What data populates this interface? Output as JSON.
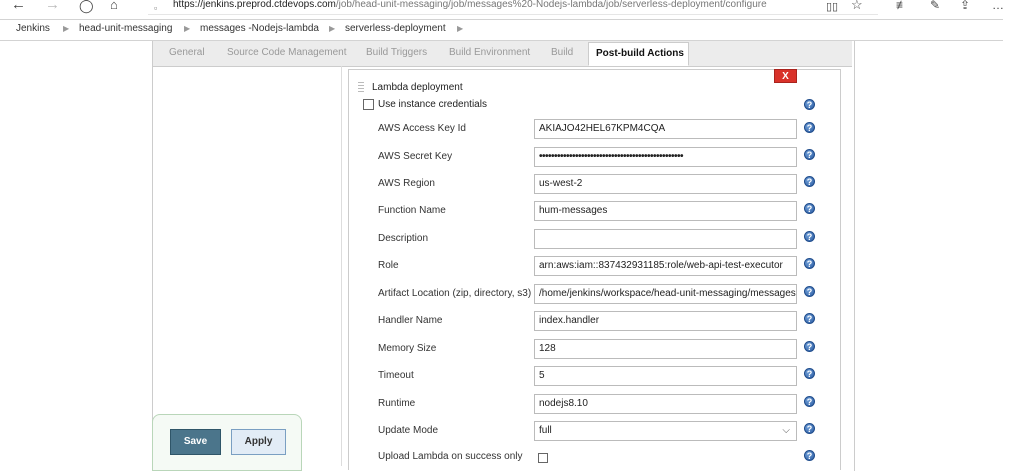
{
  "browser": {
    "url_domain": "https://jenkins.preprod.ctdevops.com",
    "url_path": "/job/head-unit-messaging/job/messages%20-Nodejs-lambda/job/serverless-deployment/configure",
    "icons": [
      "back-icon",
      "forward-icon",
      "refresh-icon",
      "home-icon",
      "lock-icon",
      "reading-view-icon",
      "favorite-star-icon",
      "favorites-list-icon",
      "pen-icon",
      "share-icon",
      "more-icon"
    ]
  },
  "breadcrumb": [
    "Jenkins",
    "head-unit-messaging",
    "messages -Nodejs-lambda",
    "serverless-deployment"
  ],
  "tabs": [
    "General",
    "Source Code Management",
    "Build Triggers",
    "Build Environment",
    "Build",
    "Post-build Actions"
  ],
  "active_tab": "Post-build Actions",
  "section": {
    "title": "Lambda deployment",
    "delete_label": "X",
    "use_instance_credentials": {
      "label": "Use instance credentials",
      "checked": false
    }
  },
  "fields": {
    "access_key": {
      "label": "AWS Access Key Id",
      "value": "AKIAJO42HEL67KPM4CQA"
    },
    "secret_key": {
      "label": "AWS Secret Key",
      "value": "••••••••••••••••••••••••••••••••••••••••••••••••"
    },
    "region": {
      "label": "AWS Region",
      "value": "us-west-2"
    },
    "function_name": {
      "label": "Function Name",
      "value": "hum-messages"
    },
    "description": {
      "label": "Description",
      "value": ""
    },
    "role": {
      "label": "Role",
      "value": "arn:aws:iam::837432931185:role/web-api-test-executor"
    },
    "artifact": {
      "label": "Artifact Location (zip, directory, s3)",
      "value": "/home/jenkins/workspace/head-unit-messaging/messages -"
    },
    "handler": {
      "label": "Handler Name",
      "value": "index.handler"
    },
    "memory": {
      "label": "Memory Size",
      "value": "128"
    },
    "timeout": {
      "label": "Timeout",
      "value": "5"
    },
    "runtime": {
      "label": "Runtime",
      "value": "nodejs8.10"
    },
    "update_mode": {
      "label": "Update Mode",
      "value": "full"
    },
    "upload_only": {
      "label": "Upload Lambda on success only"
    }
  },
  "buttons": {
    "save": "Save",
    "apply": "Apply"
  },
  "colors": {
    "delete_red": "#d9322a",
    "save_blue": "#4b758b",
    "help_blue": "#2a5aa0"
  }
}
